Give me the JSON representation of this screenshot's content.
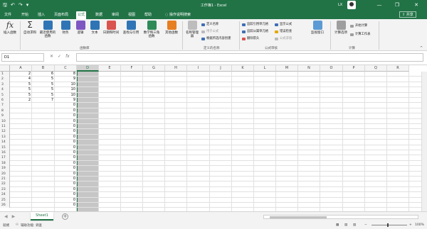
{
  "window": {
    "title": "工作簿1 - Excel",
    "user": "LX",
    "minimize": "—",
    "restore": "❐",
    "close": "✕"
  },
  "qat": {
    "save": "🖫",
    "undo": "↶",
    "redo": "↷",
    "more": "▾"
  },
  "tabs": [
    "文件",
    "开始",
    "插入",
    "页面布局",
    "公式",
    "数据",
    "审阅",
    "视图",
    "帮助"
  ],
  "active_tab": "公式",
  "tell_me": "操作说明搜索",
  "share": "共享",
  "ribbon": {
    "insert_function": "插入函数",
    "autosum": "自动求和",
    "recent": "最近使用的函数",
    "financial": "财务",
    "logical": "逻辑",
    "text": "文本",
    "datetime": "日期和时间",
    "lookup": "查找与引用",
    "math": "数学和三角函数",
    "more_functions": "其他函数",
    "group_library": "函数库",
    "name_manager": "名称管理器",
    "define_name": "定义名称",
    "use_in_formula": "用于公式",
    "create_from_selection": "根据所选内容创建",
    "group_names": "定义的名称",
    "trace_precedents": "追踪引用单元格",
    "trace_dependents": "追踪从属单元格",
    "remove_arrows": "删除箭头",
    "show_formulas": "显示公式",
    "error_checking": "错误检查",
    "evaluate_formula": "公式求值",
    "watch_window": "监视窗口",
    "group_audit": "公式审核",
    "calc_options": "计算选项",
    "calc_now": "开始计算",
    "calc_sheet": "计算工作表",
    "group_calc": "计算"
  },
  "formula_bar": {
    "name_box": "D1",
    "cancel": "✕",
    "enter": "✓",
    "fx": "fx",
    "value": ""
  },
  "columns": [
    "A",
    "B",
    "C",
    "D",
    "E",
    "F",
    "G",
    "H",
    "I",
    "J",
    "K",
    "L",
    "M",
    "N",
    "O",
    "P",
    "Q",
    "R"
  ],
  "rows": [
    "1",
    "2",
    "3",
    "4",
    "5",
    "6",
    "7",
    "8",
    "9",
    "10",
    "11",
    "12",
    "13",
    "14",
    "15",
    "16",
    "17",
    "18",
    "19",
    "20",
    "21",
    "22",
    "23",
    "24",
    "25",
    "26"
  ],
  "cells": {
    "A": [
      "2",
      "4",
      "5",
      "5",
      "5",
      "2"
    ],
    "B": [
      "6",
      "5",
      "5",
      "5",
      "5",
      "7"
    ],
    "C": [
      "8",
      "9",
      "10",
      "10",
      "10",
      "9",
      "0",
      "0",
      "0",
      "0",
      "0",
      "0",
      "0",
      "0",
      "0",
      "0",
      "0",
      "0",
      "0",
      "0",
      "0",
      "0",
      "0",
      "0",
      "0",
      "0"
    ]
  },
  "sheet_tab": "Sheet1",
  "add_sheet": "+",
  "status": {
    "ready": "就绪",
    "accessibility": "辅助功能: 调查",
    "zoom": "100%"
  },
  "colors": {
    "brand": "#217346",
    "selection": "#c6c6c6"
  }
}
